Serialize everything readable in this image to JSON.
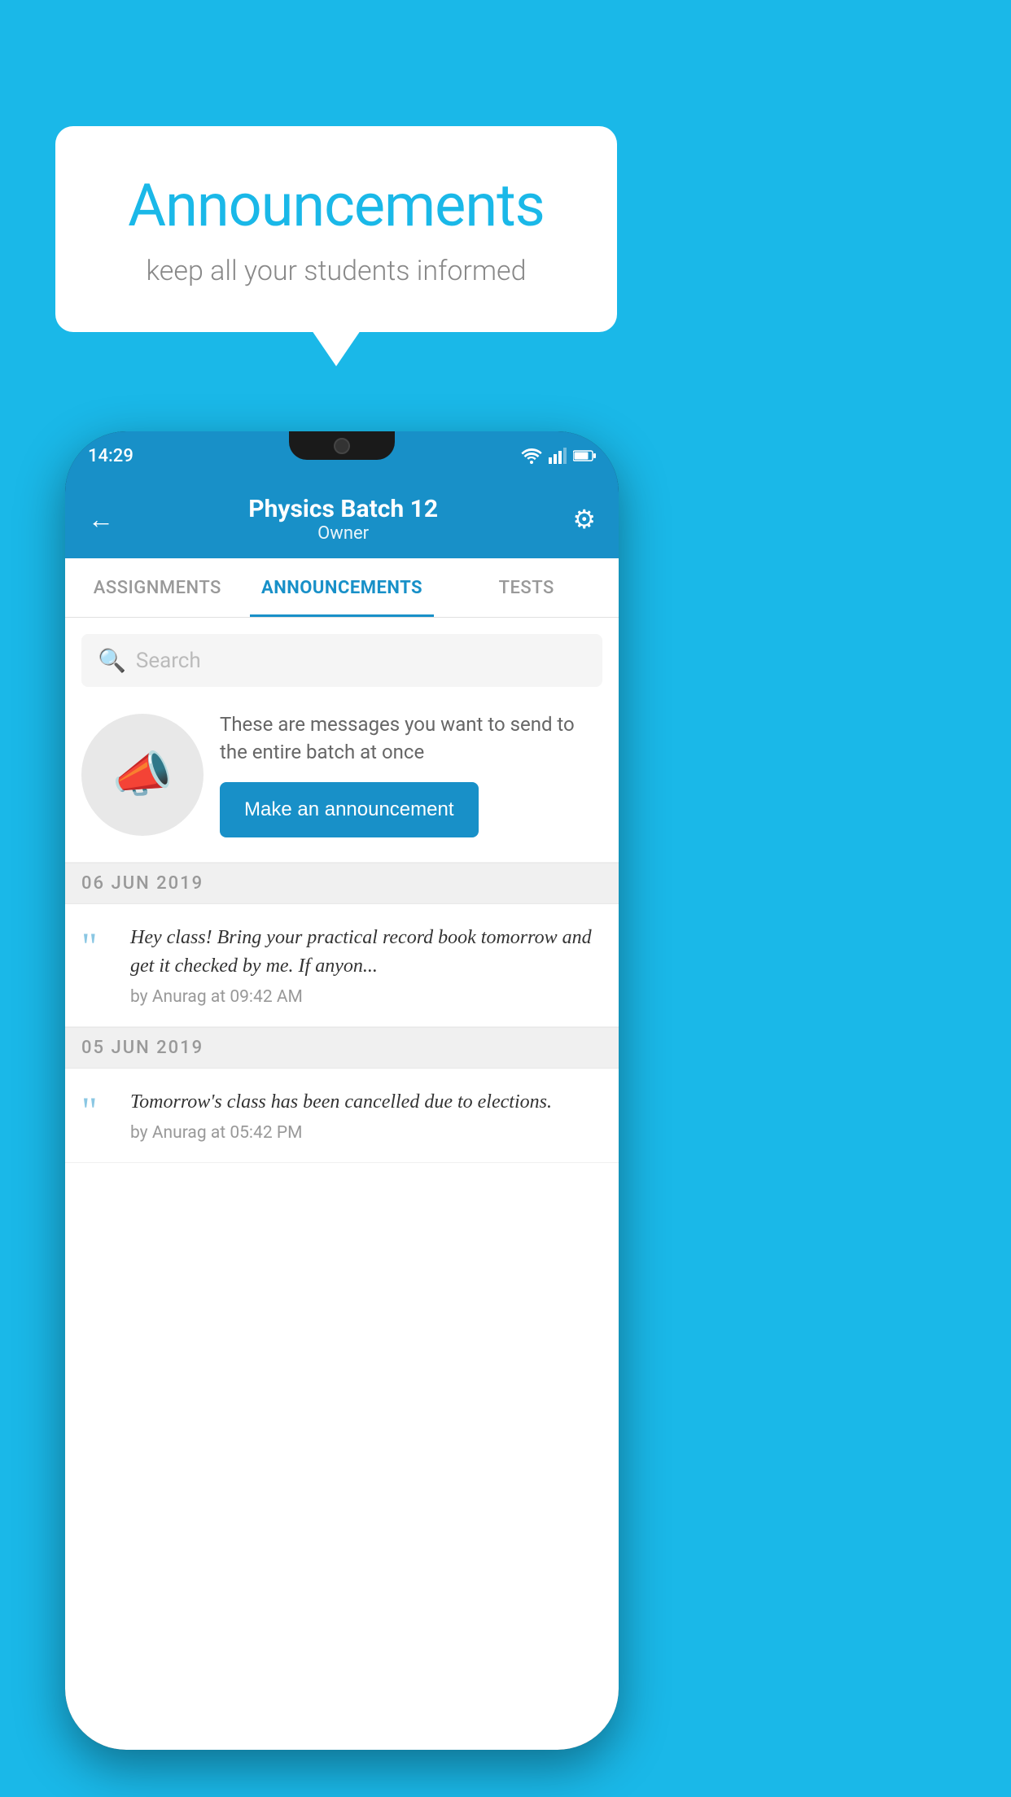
{
  "page": {
    "background_color": "#1ab8e8"
  },
  "speech_bubble": {
    "title": "Announcements",
    "subtitle": "keep all your students informed"
  },
  "status_bar": {
    "time": "14:29",
    "icons": [
      "wifi",
      "signal",
      "battery"
    ]
  },
  "app_header": {
    "back_label": "←",
    "title": "Physics Batch 12",
    "subtitle": "Owner",
    "gear_label": "⚙"
  },
  "tabs": [
    {
      "label": "ASSIGNMENTS",
      "active": false
    },
    {
      "label": "ANNOUNCEMENTS",
      "active": true
    },
    {
      "label": "TESTS",
      "active": false
    },
    {
      "label": "...",
      "active": false
    }
  ],
  "search": {
    "placeholder": "Search"
  },
  "promo": {
    "description": "These are messages you want to send to the entire batch at once",
    "button_label": "Make an announcement"
  },
  "announcements": [
    {
      "date": "06  JUN  2019",
      "text": "Hey class! Bring your practical record book tomorrow and get it checked by me. If anyon...",
      "meta": "by Anurag at 09:42 AM"
    },
    {
      "date": "05  JUN  2019",
      "text": "Tomorrow's class has been cancelled due to elections.",
      "meta": "by Anurag at 05:42 PM"
    }
  ]
}
